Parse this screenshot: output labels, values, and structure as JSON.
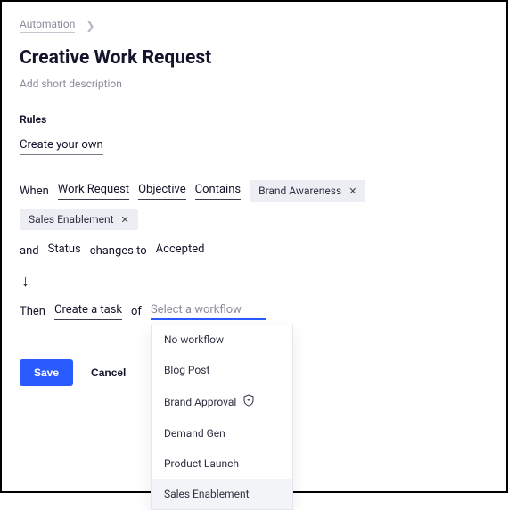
{
  "breadcrumb": {
    "root": "Automation"
  },
  "page": {
    "title": "Creative Work Request",
    "subtitle": "Add short description"
  },
  "rules": {
    "section_label": "Rules",
    "template_name": "Create your own",
    "when_label": "When",
    "and_label": "and",
    "then_label": "Then",
    "of_label": "of",
    "changes_to_label": "changes to",
    "trigger": {
      "object": "Work Request",
      "field": "Objective",
      "operator": "Contains",
      "values": [
        "Brand Awareness",
        "Sales Enablement"
      ]
    },
    "condition": {
      "field": "Status",
      "target_value": "Accepted"
    },
    "action": {
      "type": "Create a task",
      "workflow_placeholder": "Select a workflow",
      "workflow_selected": "",
      "workflow_options": [
        {
          "label": "No workflow",
          "has_shield": false
        },
        {
          "label": "Blog Post",
          "has_shield": false
        },
        {
          "label": "Brand Approval",
          "has_shield": true
        },
        {
          "label": "Demand Gen",
          "has_shield": false
        },
        {
          "label": "Product Launch",
          "has_shield": false
        },
        {
          "label": "Sales Enablement",
          "has_shield": false
        }
      ],
      "hovered_option": "Sales Enablement"
    }
  },
  "buttons": {
    "save": "Save",
    "cancel": "Cancel"
  }
}
